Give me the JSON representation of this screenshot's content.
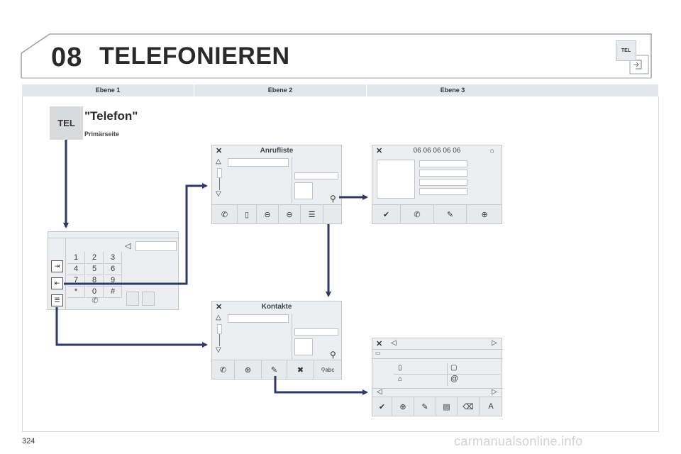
{
  "header": {
    "chapter_number": "08",
    "chapter_title": "TELEFONIEREN",
    "badge": "TEL"
  },
  "levels": [
    "Ebene 1",
    "Ebene 2",
    "Ebene 3"
  ],
  "primary": {
    "button": "TEL",
    "title": "\"Telefon\"",
    "subtitle": "Primärseite"
  },
  "keypad": {
    "rows": [
      [
        "1",
        "2",
        "3"
      ],
      [
        "4",
        "5",
        "6"
      ],
      [
        "7",
        "8",
        "9"
      ],
      [
        "*",
        "0",
        "#"
      ]
    ]
  },
  "screens": {
    "anrufliste": {
      "title": "Anrufliste"
    },
    "number": {
      "title": "06 06 06 06 06"
    },
    "kontakte": {
      "title": "Kontakte"
    },
    "contact_edit": {
      "email_symbol": "@"
    }
  },
  "colors": {
    "arrow": "#2b3a67",
    "screen_bg": "#eceef0",
    "level_bar": "#e4e6e8"
  },
  "icons": [
    "close-icon",
    "phone-icon",
    "call-in-icon",
    "call-out-icon",
    "contacts-icon",
    "checkmark-icon",
    "edit-contact-icon",
    "add-contact-icon",
    "search-abc-icon",
    "mobile-icon",
    "home-icon",
    "work-icon",
    "delete-icon"
  ],
  "page_number": "324",
  "watermark": "carmanualsonline.info"
}
